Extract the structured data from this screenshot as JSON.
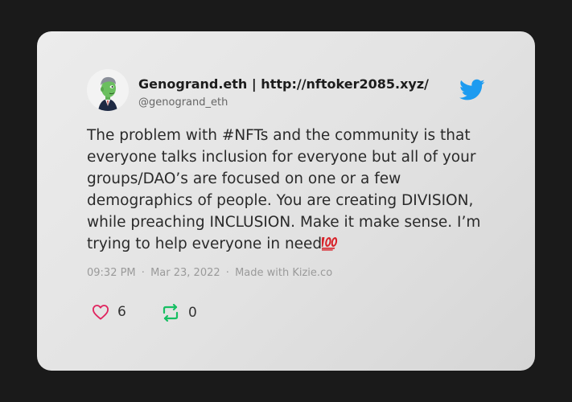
{
  "tweet": {
    "author_name": "Genogrand.eth | http://nftoker2085.xyz/",
    "handle": "@genogrand_eth",
    "text": "The problem with #NFTs and the community is that everyone talks inclusion for everyone but all of your groups/DAO’s are focused on one or a few demographics of people. You are creating DIVISION, while preaching INCLUSION. Make it make sense. I’m trying to help everyone in need",
    "emoji": "100-emoji",
    "time": "09:32 PM",
    "date": "Mar 23, 2022",
    "made_with": "Made with Kizie.co",
    "separator": "·",
    "like_count": "6",
    "retweet_count": "0"
  },
  "icons": {
    "logo": "twitter-bird-icon",
    "like": "heart-icon",
    "retweet": "retweet-icon"
  },
  "colors": {
    "background": "#1a1a1a",
    "card": "#e4e4e4",
    "twitter_blue": "#1d9bf0",
    "heart": "#e0245e",
    "retweet": "#17bf63",
    "emoji_red": "#d8232a"
  }
}
